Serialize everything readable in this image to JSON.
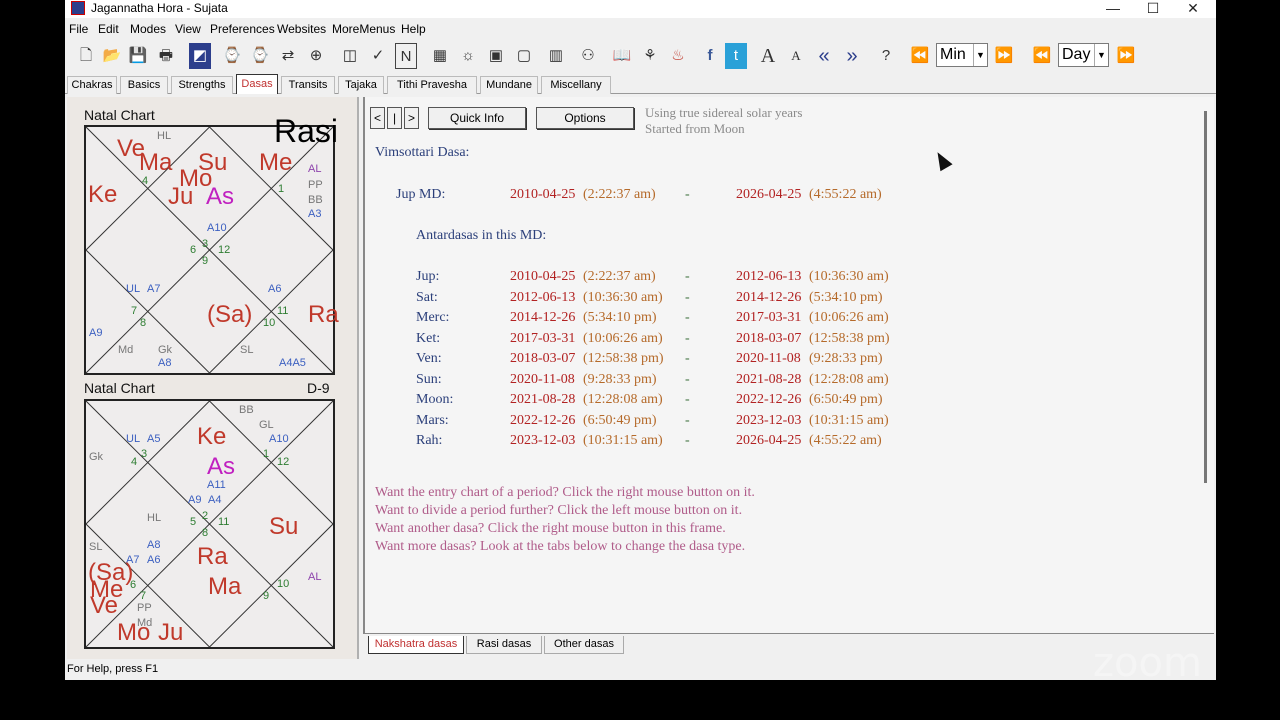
{
  "window": {
    "title": "Jagannatha Hora - Sujata",
    "minimize": "—",
    "maximize": "☐",
    "close": "✕"
  },
  "menu": [
    "File",
    "Edit",
    "Modes",
    "View",
    "Preferences",
    "Websites",
    "MoreMenus",
    "Help"
  ],
  "toolbar": {
    "zoom_select": "Min",
    "period_select": "Day"
  },
  "tabs": [
    "Chakras",
    "Basics",
    "Strengths",
    "Dasas",
    "Transits",
    "Tajaka",
    "Tithi Pravesha",
    "Mundane",
    "Miscellany"
  ],
  "active_tab": "Dasas",
  "chart1": {
    "label": "Natal Chart",
    "title": "Rasi",
    "cells": [
      "HL",
      "Ve",
      "Ma",
      "4",
      "Mo",
      "Ju",
      "Su",
      "As",
      "Me",
      "AL",
      "PP",
      "BB",
      "A3",
      "Ke",
      "Gk",
      "1",
      "A10",
      "3",
      "6",
      "12",
      "9",
      "UL",
      "A7",
      "A6",
      "7",
      "8",
      "(Sa)",
      "10",
      "11",
      "Ra",
      "A9",
      "Md",
      "Gk",
      "A8",
      "SL",
      "A4A5",
      "5",
      "2"
    ]
  },
  "chart2": {
    "label": "Natal Chart",
    "title": "D-9",
    "cells": [
      "BB",
      "GL",
      "UL",
      "A5",
      "Ke",
      "A10",
      "Gk",
      "4",
      "3",
      "1",
      "12",
      "As",
      "A11",
      "A9",
      "A4",
      "HL",
      "2",
      "5",
      "11",
      "Su",
      "8",
      "SL",
      "A8",
      "A7",
      "A6",
      "Ra",
      "(Sa)",
      "Me",
      "Ve",
      "6",
      "7",
      "Ma",
      "9",
      "10",
      "AL",
      "PP",
      "Md",
      "Mo",
      "Ju"
    ]
  },
  "controls": {
    "prev": "<",
    "pause": "|",
    "next": ">",
    "quick_info": "Quick Info",
    "options": "Options"
  },
  "info_lines": [
    "Using true sidereal solar years",
    "Started from Moon"
  ],
  "dasa_name": "Vimsottari Dasa:",
  "md": {
    "name": "Jup MD:",
    "start": "2010-04-25",
    "start_time": "(2:22:37 am)",
    "sep": "-",
    "end": "2026-04-25",
    "end_time": "(4:55:22 am)"
  },
  "antardasa_heading": "Antardasas in this MD:",
  "antardasas": [
    {
      "name": "Jup:",
      "start": "2010-04-25",
      "start_time": "(2:22:37 am)",
      "sep": "-",
      "end": "2012-06-13",
      "end_time": "(10:36:30 am)"
    },
    {
      "name": "Sat:",
      "start": "2012-06-13",
      "start_time": "(10:36:30 am)",
      "sep": "-",
      "end": "2014-12-26",
      "end_time": "(5:34:10 pm)"
    },
    {
      "name": "Merc:",
      "start": "2014-12-26",
      "start_time": "(5:34:10 pm)",
      "sep": "-",
      "end": "2017-03-31",
      "end_time": "(10:06:26 am)"
    },
    {
      "name": "Ket:",
      "start": "2017-03-31",
      "start_time": "(10:06:26 am)",
      "sep": "-",
      "end": "2018-03-07",
      "end_time": "(12:58:38 pm)"
    },
    {
      "name": "Ven:",
      "start": "2018-03-07",
      "start_time": "(12:58:38 pm)",
      "sep": "-",
      "end": "2020-11-08",
      "end_time": "(9:28:33 pm)"
    },
    {
      "name": "Sun:",
      "start": "2020-11-08",
      "start_time": "(9:28:33 pm)",
      "sep": "-",
      "end": "2021-08-28",
      "end_time": "(12:28:08 am)"
    },
    {
      "name": "Moon:",
      "start": "2021-08-28",
      "start_time": "(12:28:08 am)",
      "sep": "-",
      "end": "2022-12-26",
      "end_time": "(6:50:49 pm)"
    },
    {
      "name": "Mars:",
      "start": "2022-12-26",
      "start_time": "(6:50:49 pm)",
      "sep": "-",
      "end": "2023-12-03",
      "end_time": "(10:31:15 am)"
    },
    {
      "name": "Rah:",
      "start": "2023-12-03",
      "start_time": "(10:31:15 am)",
      "sep": "-",
      "end": "2026-04-25",
      "end_time": "(4:55:22 am)"
    }
  ],
  "help_lines": [
    "Want the entry chart of a period? Click the right mouse button on it.",
    "Want to divide a period further? Click the left mouse button on it.",
    "Want another dasa? Click the right mouse button in this frame.",
    "Want more dasas? Look at the tabs below to change the dasa type."
  ],
  "bottom_tabs": [
    "Nakshatra dasas",
    "Rasi dasas",
    "Other dasas"
  ],
  "status": "For Help, press F1",
  "watermark": "zoom"
}
